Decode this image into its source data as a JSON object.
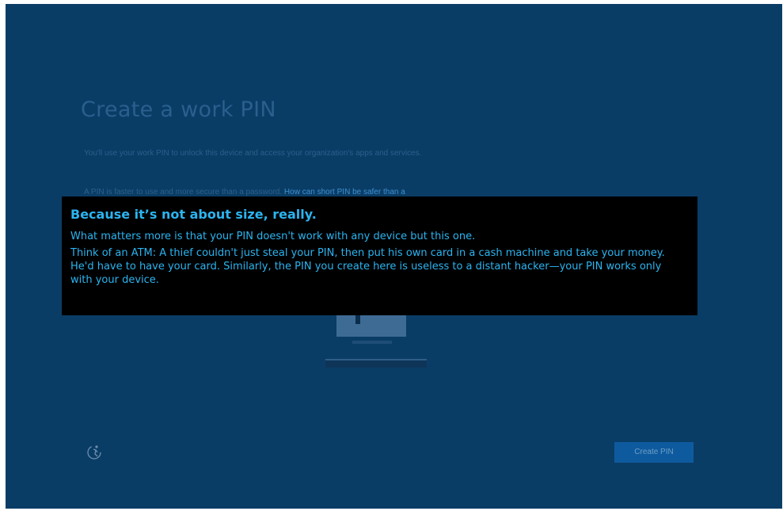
{
  "page": {
    "title": "Create a work PIN",
    "intro_text": "You'll use your work PIN to unlock this device and access your organization's apps and services.",
    "pin_text": "A PIN is faster to use and more secure than a password.",
    "link_text": "How can short PIN be safer than a",
    "create_button_label": "Create PIN",
    "accessibility_icon": "ease-of-access-icon"
  },
  "tooltip": {
    "title": "Because it’s not about size, really.",
    "paragraph1": "What matters more is that your PIN doesn't work with any device but this one.",
    "paragraph2": "Think of an ATM: A thief couldn't just steal your PIN, then put his own card in a cash machine and take your money. He'd have to have your card. Similarly, the PIN you create here is useless to a distant hacker—your PIN works only with your device."
  },
  "colors": {
    "background": "#0a3d66",
    "tooltip_background": "#000000",
    "tooltip_text": "#2bb4f0",
    "button": "#0e5a9e"
  }
}
